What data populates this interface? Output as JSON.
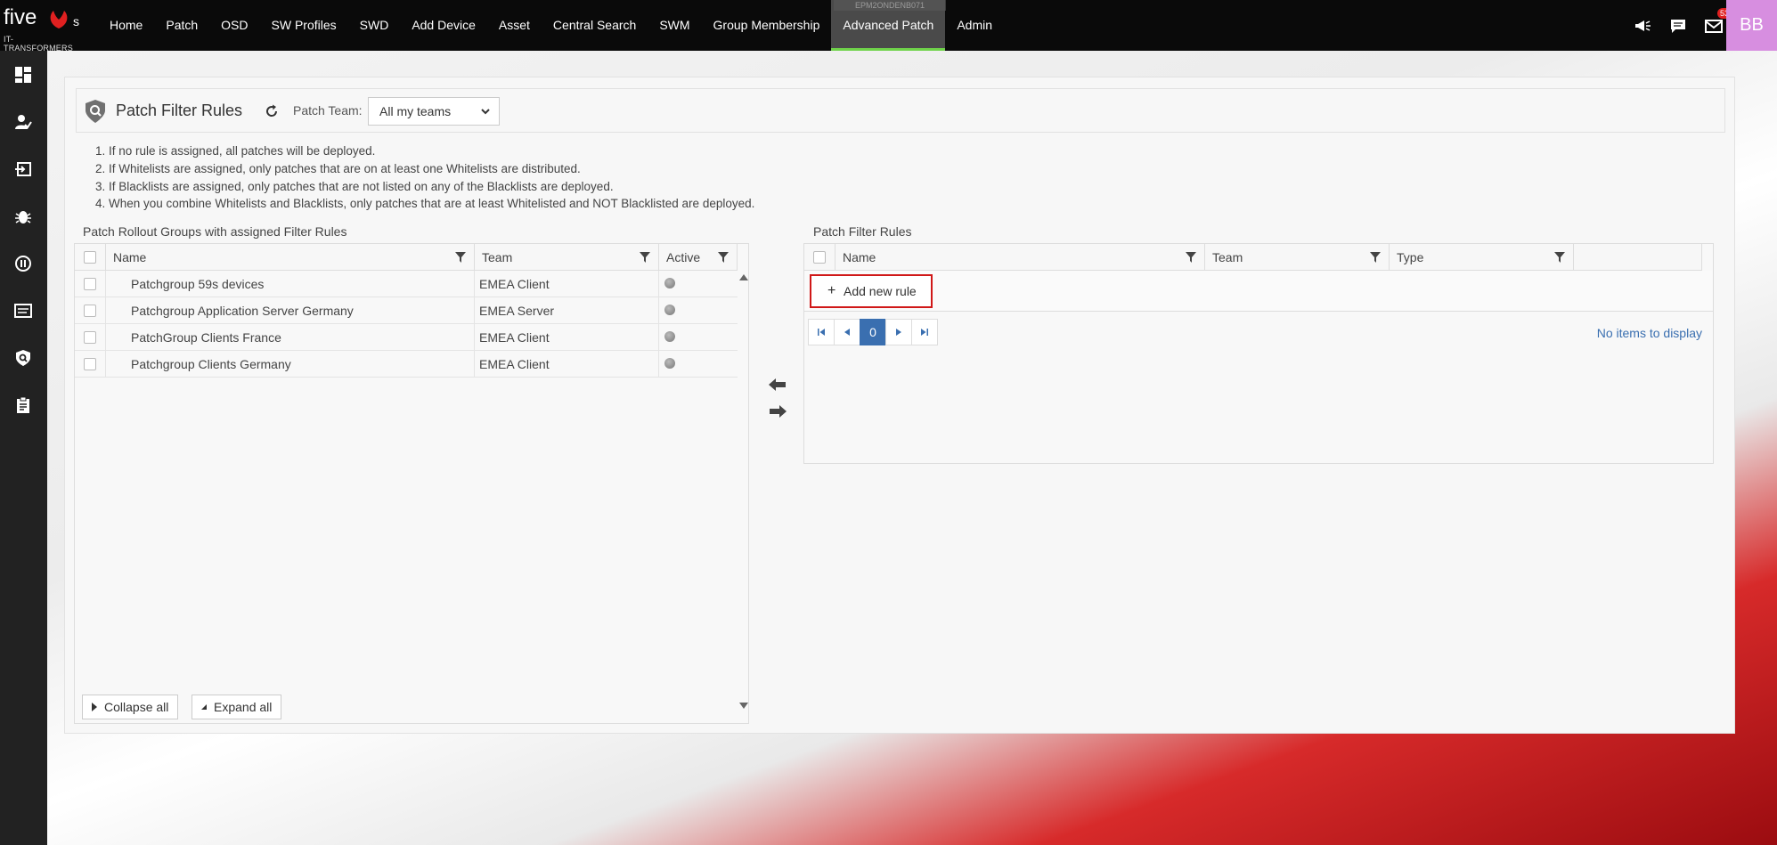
{
  "brand": {
    "logo_word": "five",
    "logo_suffix": "s",
    "tagline": "IT-TRANSFORMERS"
  },
  "host_label": "EPM2ONDENB071",
  "nav": [
    {
      "label": "Home"
    },
    {
      "label": "Patch"
    },
    {
      "label": "OSD"
    },
    {
      "label": "SW Profiles"
    },
    {
      "label": "SWD"
    },
    {
      "label": "Add Device"
    },
    {
      "label": "Asset"
    },
    {
      "label": "Central Search"
    },
    {
      "label": "SWM"
    },
    {
      "label": "Group Membership"
    },
    {
      "label": "Advanced Patch"
    },
    {
      "label": "Admin"
    }
  ],
  "top_icons": {
    "announcements": "megaphone-icon",
    "chat": "chat-icon",
    "mail": "mail-icon",
    "mail_badge": "53"
  },
  "avatar": "BB",
  "sidebar": [
    "dashboard-icon",
    "user-check-icon",
    "login-icon",
    "bug-icon",
    "pause-icon",
    "list-icon",
    "shield-search-icon",
    "clipboard-icon"
  ],
  "header": {
    "title": "Patch Filter Rules",
    "team_label": "Patch Team:",
    "team_value": "All my teams"
  },
  "rules": [
    "1. If no rule is assigned, all patches will be deployed.",
    "2. If Whitelists are assigned, only patches that are on at least one Whitelists are distributed.",
    "3. If Blacklists are assigned, only patches that are not listed on any of the Blacklists are deployed.",
    "4. When you combine Whitelists and Blacklists, only patches that are at least Whitelisted and NOT Blacklisted are deployed."
  ],
  "left_grid": {
    "title": "Patch Rollout Groups with assigned Filter Rules",
    "columns": [
      "Name",
      "Team",
      "Active"
    ],
    "rows": [
      {
        "name": "Patchgroup 59s devices",
        "team": "EMEA Client"
      },
      {
        "name": "Patchgroup Application Server Germany",
        "team": "EMEA Server"
      },
      {
        "name": "PatchGroup Clients France",
        "team": "EMEA Client"
      },
      {
        "name": "Patchgroup Clients Germany",
        "team": "EMEA Client"
      }
    ],
    "collapse_label": "Collapse all",
    "expand_label": "Expand all"
  },
  "right_grid": {
    "title": "Patch Filter Rules",
    "columns": [
      "Name",
      "Team",
      "Type"
    ],
    "add_label": "Add new rule",
    "page": "0",
    "empty_label": "No items to display"
  },
  "colors": {
    "accent": "#3a6fb0",
    "highlight": "#d01818",
    "active_nav_underline": "#6fd34a"
  }
}
